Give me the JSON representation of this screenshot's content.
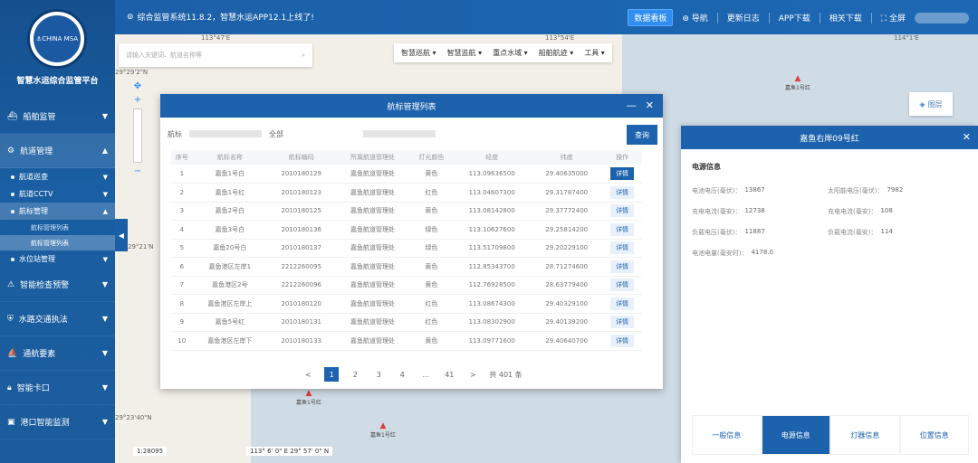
{
  "topbar": {
    "notice": "综合监管系统11.8.2，智慧水运APP12.1上线了!",
    "nav": [
      "数据看板",
      "导航",
      "更新日志",
      "APP下载",
      "相关下载",
      "全屏"
    ]
  },
  "sidebar": {
    "logo_text": "CHINA MSA",
    "title": "智慧水运综合监管平台",
    "menu": [
      {
        "label": "船舶监管"
      },
      {
        "label": "航道管理"
      }
    ],
    "sub": [
      {
        "label": "航道巡查"
      },
      {
        "label": "航道CCTV"
      },
      {
        "label": "航标管理"
      }
    ],
    "subsub": [
      {
        "label": "航标管理列表"
      },
      {
        "label": "航标管理列表"
      }
    ],
    "sub2": [
      {
        "label": "水位站管理"
      }
    ],
    "menu2": [
      {
        "label": "智能检查预警"
      },
      {
        "label": "水路交通执法"
      },
      {
        "label": "通航要素"
      },
      {
        "label": "智能卡口"
      },
      {
        "label": "港口智能监测"
      }
    ]
  },
  "map": {
    "coords_top": [
      "113°47'E",
      "113°54'E",
      "114°1'E"
    ],
    "coords_left": [
      "29°29'2\"N",
      "29°21'N",
      "29°23'40\"N"
    ],
    "toolbar": [
      "智慧巡航",
      "智慧监航",
      "重点水域",
      "船舶航迹",
      "工具"
    ],
    "search_placeholder": "请输入关键词、航道名称等",
    "layer": "图层",
    "markers": [
      {
        "label": "嘉鱼1号红"
      },
      {
        "label": "嘉鱼1号红"
      },
      {
        "label": "嘉鱼1号红"
      }
    ],
    "scale": "1:28095",
    "coordinate": "113° 6' 0\" E 29° 57' 0\" N"
  },
  "dialog": {
    "title": "航标管理列表",
    "filter_label": "航标",
    "filter_all": "全部",
    "query": "查询",
    "headers": [
      "序号",
      "航标名称",
      "航标编码",
      "所属航道管理处",
      "灯光颜色",
      "经度",
      "纬度",
      "操作"
    ],
    "rows": [
      [
        "1",
        "嘉鱼1号白",
        "2010180129",
        "嘉鱼航道管理处",
        "黄色",
        "113.09636500",
        "29.40635000",
        "详情"
      ],
      [
        "2",
        "嘉鱼1号红",
        "2010180123",
        "嘉鱼航道管理处",
        "红色",
        "113.04607300",
        "29.31787400",
        "详情"
      ],
      [
        "3",
        "嘉鱼2号白",
        "2010180125",
        "嘉鱼航道管理处",
        "黄色",
        "113.08142800",
        "29.37772400",
        "详情"
      ],
      [
        "4",
        "嘉鱼3号白",
        "2010180136",
        "嘉鱼航道管理处",
        "绿色",
        "113.10627600",
        "29.25814200",
        "详情"
      ],
      [
        "5",
        "嘉鱼20号白",
        "2010180137",
        "嘉鱼航道管理处",
        "绿色",
        "113.51709800",
        "29.20229100",
        "详情"
      ],
      [
        "6",
        "嘉鱼港区左岸1",
        "2212260095",
        "嘉鱼航道管理处",
        "黄色",
        "112.85343700",
        "28.71274600",
        "详情"
      ],
      [
        "7",
        "嘉鱼港区2号",
        "2212260096",
        "嘉鱼航道管理处",
        "黄色",
        "112.76928500",
        "28.63779400",
        "详情"
      ],
      [
        "8",
        "嘉鱼港区左岸上",
        "2010180120",
        "嘉鱼航道管理处",
        "红色",
        "113.08674300",
        "29.40329100",
        "详情"
      ],
      [
        "9",
        "嘉鱼5号红",
        "2010180131",
        "嘉鱼航道管理处",
        "红色",
        "113.08302900",
        "29.40139200",
        "详情"
      ],
      [
        "10",
        "嘉鱼港区左岸下",
        "2010180133",
        "嘉鱼航道管理处",
        "黄色",
        "113.09771600",
        "29.40640700",
        "详情"
      ]
    ],
    "pager": [
      "<",
      "1",
      "2",
      "3",
      "4",
      "...",
      "41",
      ">"
    ],
    "pager_total": "共 401 条"
  },
  "panel": {
    "title": "嘉鱼右岸09号红",
    "section": "电源信息",
    "fields": [
      {
        "k": "电池电压(毫伏)：",
        "v": "13867",
        "k2": "太阳能电压(毫伏)：",
        "v2": "7982"
      },
      {
        "k": "充电电流(毫安)：",
        "v": "12738",
        "k2": "充电电流(毫安)：",
        "v2": "108"
      },
      {
        "k": "负载电压(毫伏)：",
        "v": "11887",
        "k2": "负载电流(毫安)：",
        "v2": "114"
      },
      {
        "k": "电池电量(毫安时)：",
        "v": "4178.0",
        "k2": "",
        "v2": ""
      }
    ],
    "tabs": [
      "一般信息",
      "电源信息",
      "灯器信息",
      "位置信息"
    ]
  }
}
